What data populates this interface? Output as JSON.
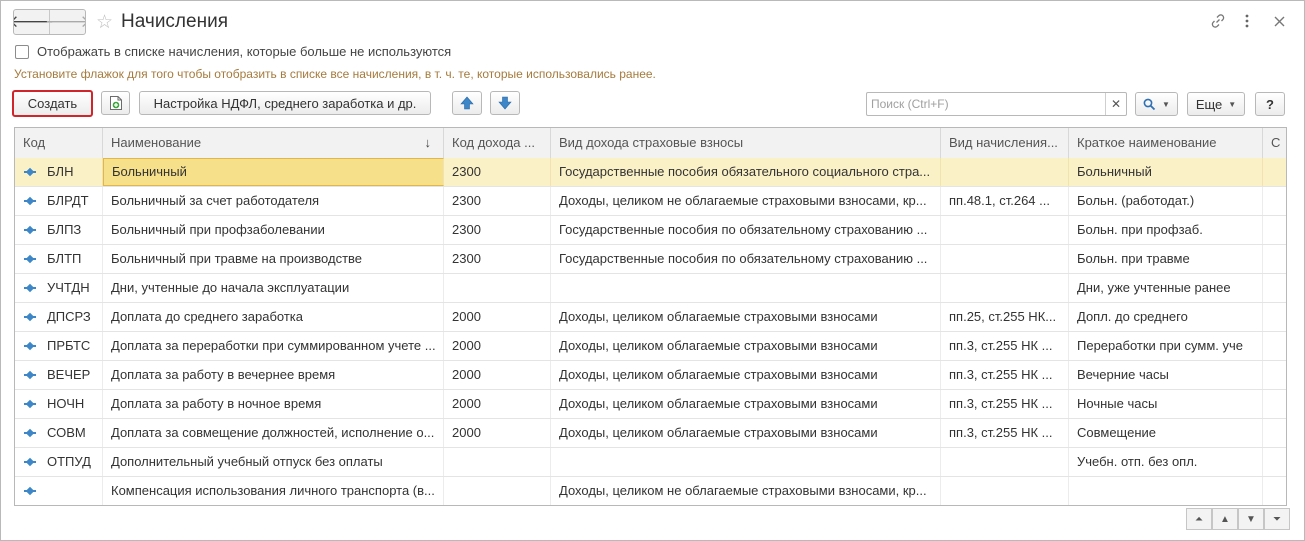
{
  "window": {
    "title": "Начисления",
    "back_icon": "arrow-left-icon",
    "forward_icon": "arrow-right-icon",
    "favorite_icon": "star-icon",
    "link_icon": "link-icon",
    "more_icon": "more-vertical-icon",
    "close_icon": "close-icon"
  },
  "filter": {
    "show_unused_label": "Отображать в списке начисления, которые больше не используются",
    "show_unused_checked": false,
    "hint": "Установите флажок для того чтобы отобразить в списке все начисления, в т. ч. те, которые использовались ранее."
  },
  "toolbar": {
    "create_label": "Создать",
    "ndfl_settings_label": "Настройка НДФЛ, среднего заработка и др.",
    "search_placeholder": "Поиск (Ctrl+F)",
    "search_value": "",
    "more_label": "Еще",
    "help_label": "?"
  },
  "table": {
    "columns": [
      "Код",
      "Наименование",
      "Код дохода ...",
      "Вид дохода страховые взносы",
      "Вид начисления...",
      "Краткое наименование",
      "С"
    ],
    "sort_indicator": "↓",
    "rows": [
      {
        "code": "БЛН",
        "name": "Больничный",
        "income_code": "2300",
        "insurance_type": "Государственные пособия обязательного социального стра...",
        "accrual_type": "",
        "short_name": "Больничный"
      },
      {
        "code": "БЛРДТ",
        "name": "Больничный за счет работодателя",
        "income_code": "2300",
        "insurance_type": "Доходы, целиком не облагаемые страховыми взносами, кр...",
        "accrual_type": "пп.48.1, ст.264 ...",
        "short_name": "Больн. (работодат.)"
      },
      {
        "code": "БЛПЗ",
        "name": "Больничный при профзаболевании",
        "income_code": "2300",
        "insurance_type": "Государственные пособия по обязательному страхованию ...",
        "accrual_type": "",
        "short_name": "Больн. при профзаб."
      },
      {
        "code": "БЛТП",
        "name": "Больничный при травме на производстве",
        "income_code": "2300",
        "insurance_type": "Государственные пособия по обязательному страхованию ...",
        "accrual_type": "",
        "short_name": "Больн. при травме"
      },
      {
        "code": "УЧТДН",
        "name": "Дни, учтенные до начала эксплуатации",
        "income_code": "",
        "insurance_type": "",
        "accrual_type": "",
        "short_name": "Дни, уже учтенные ранее"
      },
      {
        "code": "ДПСРЗ",
        "name": "Доплата до среднего заработка",
        "income_code": "2000",
        "insurance_type": "Доходы, целиком облагаемые страховыми взносами",
        "accrual_type": "пп.25, ст.255 НК...",
        "short_name": "Допл. до среднего"
      },
      {
        "code": "ПРБТС",
        "name": "Доплата за переработки при суммированном учете ...",
        "income_code": "2000",
        "insurance_type": "Доходы, целиком облагаемые страховыми взносами",
        "accrual_type": "пп.3, ст.255 НК ...",
        "short_name": "Переработки при сумм. уче"
      },
      {
        "code": "ВЕЧЕР",
        "name": "Доплата за работу в вечернее время",
        "income_code": "2000",
        "insurance_type": "Доходы, целиком облагаемые страховыми взносами",
        "accrual_type": "пп.3, ст.255 НК ...",
        "short_name": "Вечерние часы"
      },
      {
        "code": "НОЧН",
        "name": "Доплата за работу в ночное время",
        "income_code": "2000",
        "insurance_type": "Доходы, целиком облагаемые страховыми взносами",
        "accrual_type": "пп.3, ст.255 НК ...",
        "short_name": "Ночные часы"
      },
      {
        "code": "СОВМ",
        "name": "Доплата за совмещение должностей, исполнение о...",
        "income_code": "2000",
        "insurance_type": "Доходы, целиком облагаемые страховыми взносами",
        "accrual_type": "пп.3, ст.255 НК ...",
        "short_name": "Совмещение"
      },
      {
        "code": "ОТПУД",
        "name": "Дополнительный учебный отпуск без оплаты",
        "income_code": "",
        "insurance_type": "",
        "accrual_type": "",
        "short_name": "Учебн. отп. без опл."
      },
      {
        "code": "",
        "name": "Компенсация использования личного транспорта (в...",
        "income_code": "",
        "insurance_type": "Доходы, целиком не облагаемые страховыми взносами, кр...",
        "accrual_type": "",
        "short_name": ""
      }
    ]
  },
  "colors": {
    "accent_create_border": "#d0252b",
    "hint_text": "#a57a3c",
    "selected_row": "#fbf1c7",
    "focused_cell": "#f7e08a",
    "row_icon": "#3d86c8",
    "arrow_buttons": "#3d86c8"
  }
}
